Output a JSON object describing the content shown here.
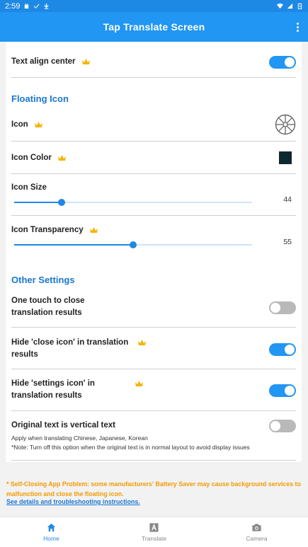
{
  "status_bar": {
    "time": "2:59"
  },
  "app_bar": {
    "title": "Tap Translate Screen"
  },
  "settings": {
    "text_align_center": {
      "label": "Text align center",
      "enabled": true
    },
    "floating_icon_section": "Floating Icon",
    "icon": {
      "label": "Icon"
    },
    "icon_color": {
      "label": "Icon Color",
      "color": "#0a2a30"
    },
    "icon_size": {
      "label": "Icon Size",
      "value": "44",
      "fraction": 0.2
    },
    "icon_transparency": {
      "label": "Icon Transparency",
      "value": "55",
      "fraction": 0.5
    },
    "other_settings_section": "Other Settings",
    "one_touch_close": {
      "label_line1": "One touch to close",
      "label_line2": "translation results",
      "enabled": false
    },
    "hide_close_icon": {
      "label_line1": "Hide 'close icon' in translation",
      "label_line2": "results",
      "enabled": true
    },
    "hide_settings_icon": {
      "label_line1": "Hide 'settings icon' in",
      "label_line2": "translation results",
      "enabled": true
    },
    "vertical_text": {
      "label": "Original text is vertical text",
      "note1": "Apply when translating Chinese, Japanese, Korean",
      "note2": "*Note: Turn off this option when the original text is in normal layout to avoid display issues",
      "enabled": false
    }
  },
  "footer": {
    "warning": "* Self-Closing App Problem: some manufacturers' Battery Saver may cause background services to malfunction and close the floating icon.",
    "link": "See details and troubleshooting instructions."
  },
  "bottom_nav": {
    "home": "Home",
    "translate": "Translate",
    "camera": "Camera",
    "active": "home"
  },
  "colors": {
    "primary": "#2196f3",
    "status_bar": "#1e88e5",
    "accent_text": "#1976d2",
    "warning": "#f59a00",
    "crown": "#f5b400"
  }
}
